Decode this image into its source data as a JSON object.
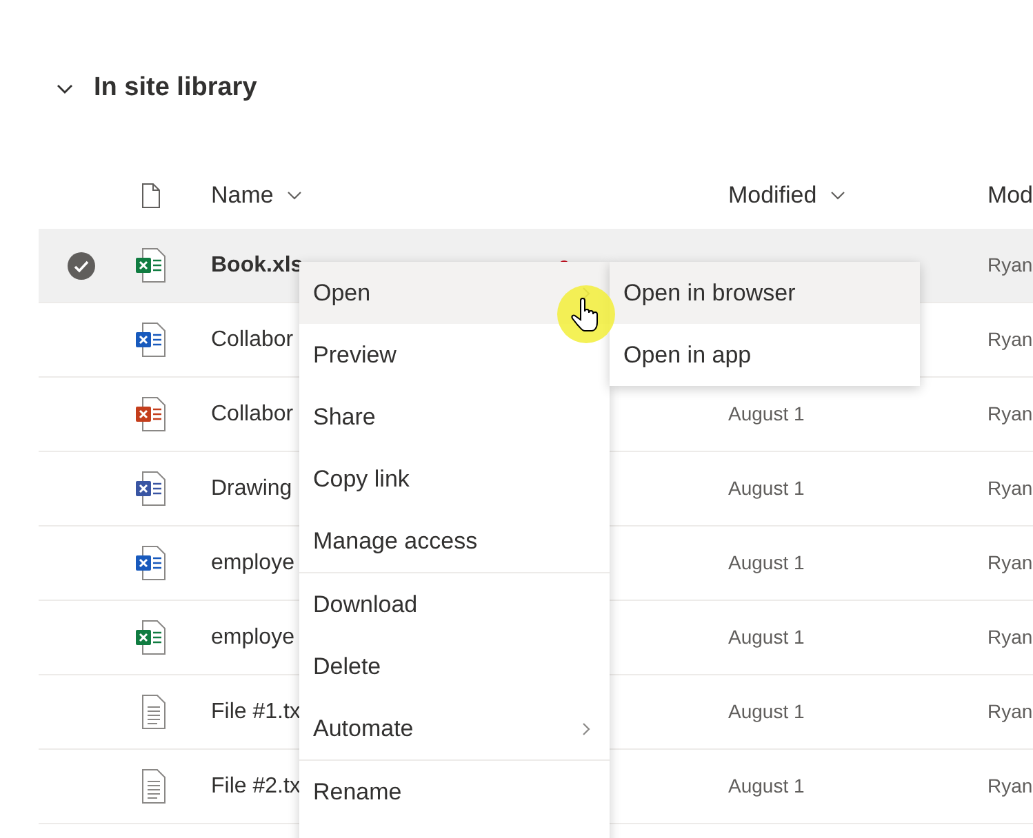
{
  "sections": [
    {
      "title": "In site library",
      "expanded": true
    }
  ],
  "table": {
    "columns": [
      "Name",
      "Modified",
      "Mod"
    ],
    "rows": [
      {
        "selected": true,
        "kind": "excel",
        "name": "Book.xls",
        "new": true,
        "modified_by": "Ryan"
      },
      {
        "selected": false,
        "kind": "word",
        "name": "Collabor",
        "modified_by": "Ryan"
      },
      {
        "selected": false,
        "kind": "powerpoint",
        "name": "Collabor",
        "modified": "August 1",
        "modified_by": "Ryan"
      },
      {
        "selected": false,
        "kind": "visio",
        "name": "Drawing",
        "modified": "August 1",
        "modified_by": "Ryan"
      },
      {
        "selected": false,
        "kind": "word",
        "name": "employe",
        "modified": "August 1",
        "modified_by": "Ryan"
      },
      {
        "selected": false,
        "kind": "excel",
        "name": "employe",
        "modified": "August 1",
        "modified_by": "Ryan"
      },
      {
        "selected": false,
        "kind": "text",
        "name": "File #1.tx",
        "modified": "August 1",
        "modified_by": "Ryan"
      },
      {
        "selected": false,
        "kind": "text",
        "name": "File #2.tx",
        "modified": "August 1",
        "modified_by": "Ryan"
      }
    ]
  },
  "context_menu": {
    "groups": [
      [
        {
          "label": "Open",
          "selected": true,
          "submenu": true
        },
        {
          "label": "Preview",
          "selected": false,
          "submenu": false
        },
        {
          "label": "Share",
          "selected": false,
          "submenu": false
        },
        {
          "label": "Copy link",
          "selected": false,
          "submenu": false
        },
        {
          "label": "Manage access",
          "selected": false,
          "submenu": false
        }
      ],
      [
        {
          "label": "Download",
          "selected": false,
          "submenu": false
        },
        {
          "label": "Delete",
          "selected": false,
          "submenu": false
        },
        {
          "label": "Automate",
          "selected": false,
          "submenu": true
        }
      ],
      [
        {
          "label": "Rename",
          "selected": false,
          "submenu": false
        }
      ]
    ]
  },
  "submenu": {
    "items": [
      {
        "label": "Open in browser",
        "selected": true
      },
      {
        "label": "Open in app",
        "selected": false
      }
    ]
  }
}
